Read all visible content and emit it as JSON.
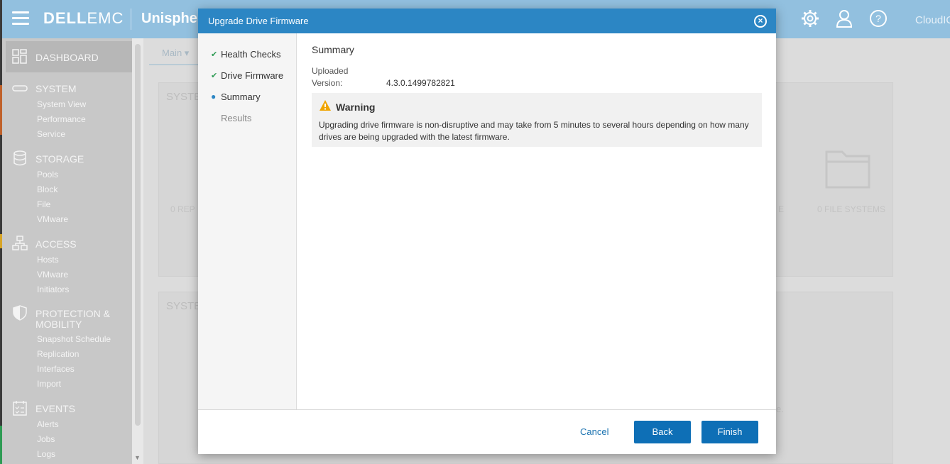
{
  "header": {
    "brand_bold": "DELL",
    "brand_light": "EMC",
    "app_name": "Unispher",
    "cloud_label": "CloudIQ"
  },
  "sidebar": {
    "dashboard": "DASHBOARD",
    "sections": [
      {
        "label": "SYSTEM",
        "items": [
          "System View",
          "Performance",
          "Service"
        ]
      },
      {
        "label": "STORAGE",
        "items": [
          "Pools",
          "Block",
          "File",
          "VMware"
        ]
      },
      {
        "label": "ACCESS",
        "items": [
          "Hosts",
          "VMware",
          "Initiators"
        ]
      },
      {
        "label": "PROTECTION &",
        "label2": "MOBILITY",
        "items": [
          "Snapshot Schedule",
          "Replication",
          "Interfaces",
          "Import"
        ]
      },
      {
        "label": "EVENTS",
        "items": [
          "Alerts",
          "Jobs",
          "Logs"
        ]
      }
    ]
  },
  "background": {
    "tab": "Main",
    "card1_title": "SYSTE",
    "card2_title": "SYSTE",
    "rep_text": "0  REP",
    "fs_text": "0  FILE SYSTEMS",
    "e_text": "E",
    "dot_text": "e."
  },
  "dialog": {
    "title": "Upgrade Drive Firmware",
    "steps": [
      {
        "label": "Health Checks",
        "state": "done"
      },
      {
        "label": "Drive Firmware",
        "state": "done"
      },
      {
        "label": "Summary",
        "state": "current"
      },
      {
        "label": "Results",
        "state": "pending"
      }
    ],
    "summary_title": "Summary",
    "uploaded_label": "Uploaded",
    "version_label": "Version:",
    "version_value": "4.3.0.1499782821",
    "warning_title": "Warning",
    "warning_text": "Upgrading drive firmware is non-disruptive and may take from 5 minutes to several hours depending on how many drives are being upgraded with the latest firmware.",
    "cancel_label": "Cancel",
    "back_label": "Back",
    "finish_label": "Finish"
  },
  "colors": {
    "accent": "#2c86c4",
    "button": "#0e6fb6",
    "check": "#2e9b54",
    "warning": "#f0a500"
  }
}
